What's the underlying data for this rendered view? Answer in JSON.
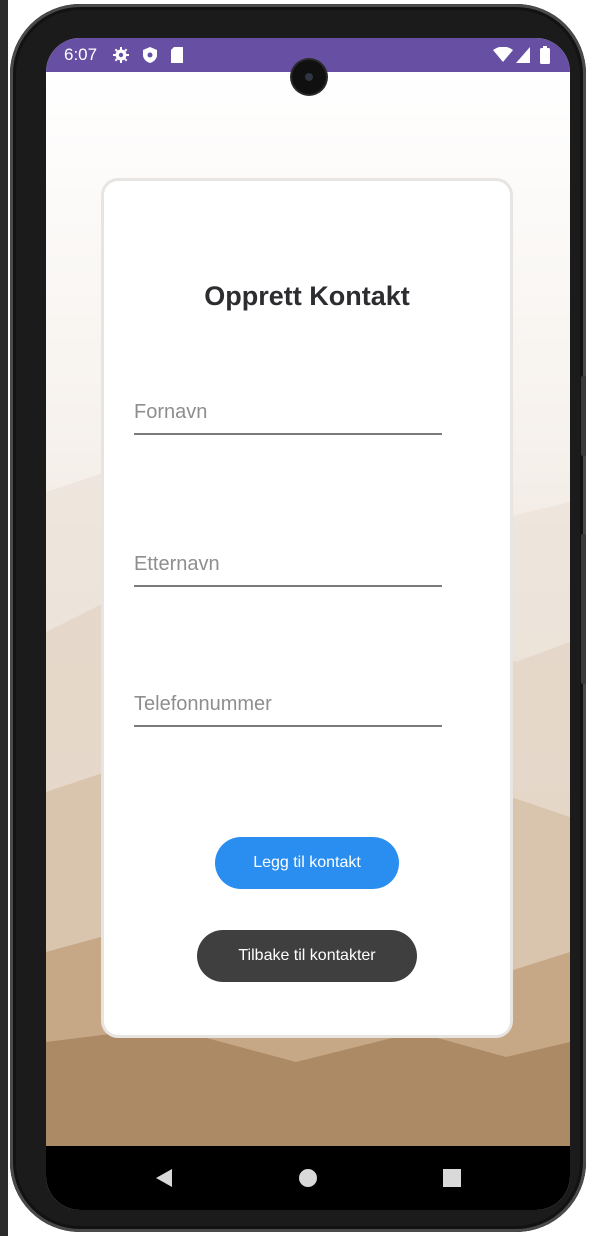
{
  "status_bar": {
    "time": "6:07",
    "left_icons": [
      "gear-icon",
      "shield-icon",
      "sd-card-icon"
    ],
    "right_icons": [
      "wifi-icon",
      "signal-icon",
      "battery-icon"
    ],
    "color": "#6750a4"
  },
  "form": {
    "title": "Opprett Kontakt",
    "first_name_placeholder": "Fornavn",
    "last_name_placeholder": "Etternavn",
    "phone_placeholder": "Telefonnummer",
    "add_button_label": "Legg til kontakt",
    "back_button_label": "Tilbake til kontakter"
  },
  "colors": {
    "primary_button": "#2a8ef0",
    "secondary_button": "#3f3f3f",
    "card_background": "#ffffff"
  },
  "nav_bar": {
    "icons": [
      "back-triangle-icon",
      "home-circle-icon",
      "recents-square-icon"
    ]
  }
}
